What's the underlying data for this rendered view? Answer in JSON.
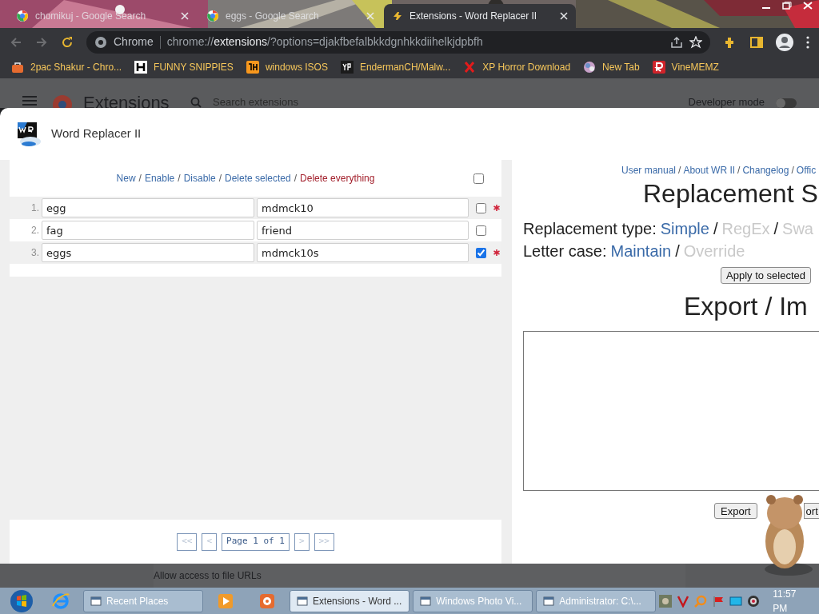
{
  "browser": {
    "tabs": [
      {
        "title": "chomikuj - Google Search",
        "selected": false
      },
      {
        "title": "eggs - Google Search",
        "selected": false
      },
      {
        "title": "Extensions - Word Replacer II",
        "selected": true
      }
    ],
    "omnibox": {
      "chip": "Chrome",
      "scheme": "chrome://",
      "host": "extensions",
      "rest": "/?options=djakfbefalbkkdgnhkkdiihelkjdpbfh"
    },
    "bookmarks": [
      {
        "label": "2pac Shakur - Chro...",
        "kind": "bag"
      },
      {
        "label": "FUNNY SNIPPIES",
        "kind": "h"
      },
      {
        "label": "windows ISOS",
        "kind": "ph"
      },
      {
        "label": "EndermanCH/Malw...",
        "kind": "yp"
      },
      {
        "label": "XP Horror Download",
        "kind": "x"
      },
      {
        "label": "New Tab",
        "kind": "globe"
      },
      {
        "label": "VineMEMZ",
        "kind": "r"
      }
    ]
  },
  "extensions_page": {
    "title": "Extensions",
    "search": {
      "placeholder": "Search extensions"
    },
    "developer_mode": "Developer mode",
    "developer_mode_on": false,
    "behind_label": "Allow access to file URLs"
  },
  "dialog": {
    "title": "Word Replacer II",
    "separator": "/",
    "actions": [
      {
        "label": "New",
        "kind": "link"
      },
      {
        "label": "Enable",
        "kind": "link"
      },
      {
        "label": "Disable",
        "kind": "link"
      },
      {
        "label": "Delete selected",
        "kind": "link"
      },
      {
        "label": "Delete everything",
        "kind": "danger"
      }
    ],
    "select_all": {
      "checked": false
    },
    "rules": [
      {
        "index": "1.",
        "find": "egg",
        "replace": "mdmck10",
        "selected": false,
        "modified": true
      },
      {
        "index": "2.",
        "find": "fag",
        "replace": "friend",
        "selected": false,
        "modified": false
      },
      {
        "index": "3.",
        "find": "eggs",
        "replace": "mdmck10s",
        "selected": true,
        "modified": true
      }
    ],
    "pagination": {
      "first": "<<",
      "prev": "<",
      "page": "Page 1 of 1",
      "next": ">",
      "last": ">>"
    },
    "links": [
      "User manual",
      "About WR II",
      "Changelog",
      "Offic"
    ],
    "heading": "Replacement S",
    "replacement_type": {
      "label": "Replacement type:",
      "options": [
        {
          "label": "Simple",
          "selected": true
        },
        {
          "label": "RegEx",
          "selected": false
        },
        {
          "label": "Swa",
          "selected": false
        }
      ]
    },
    "letter_case": {
      "label": "Letter case:",
      "options": [
        {
          "label": "Maintain",
          "selected": true
        },
        {
          "label": "Override",
          "selected": false
        }
      ]
    },
    "apply_button": "Apply to selected",
    "export_heading": "Export / Im",
    "export_button": "Export",
    "import_button": "ort"
  },
  "taskbar": {
    "items": [
      {
        "kind": "ie"
      },
      {
        "kind": "window",
        "label": "Recent Places",
        "active": false
      },
      {
        "kind": "media"
      },
      {
        "kind": "bird"
      },
      {
        "kind": "window",
        "label": "Extensions - Word ...",
        "active": true
      },
      {
        "kind": "window",
        "label": "Windows Photo Vi...",
        "active": false
      },
      {
        "kind": "window",
        "label": "Administrator: C:\\...",
        "active": false
      }
    ],
    "clock": "11:57 PM"
  }
}
